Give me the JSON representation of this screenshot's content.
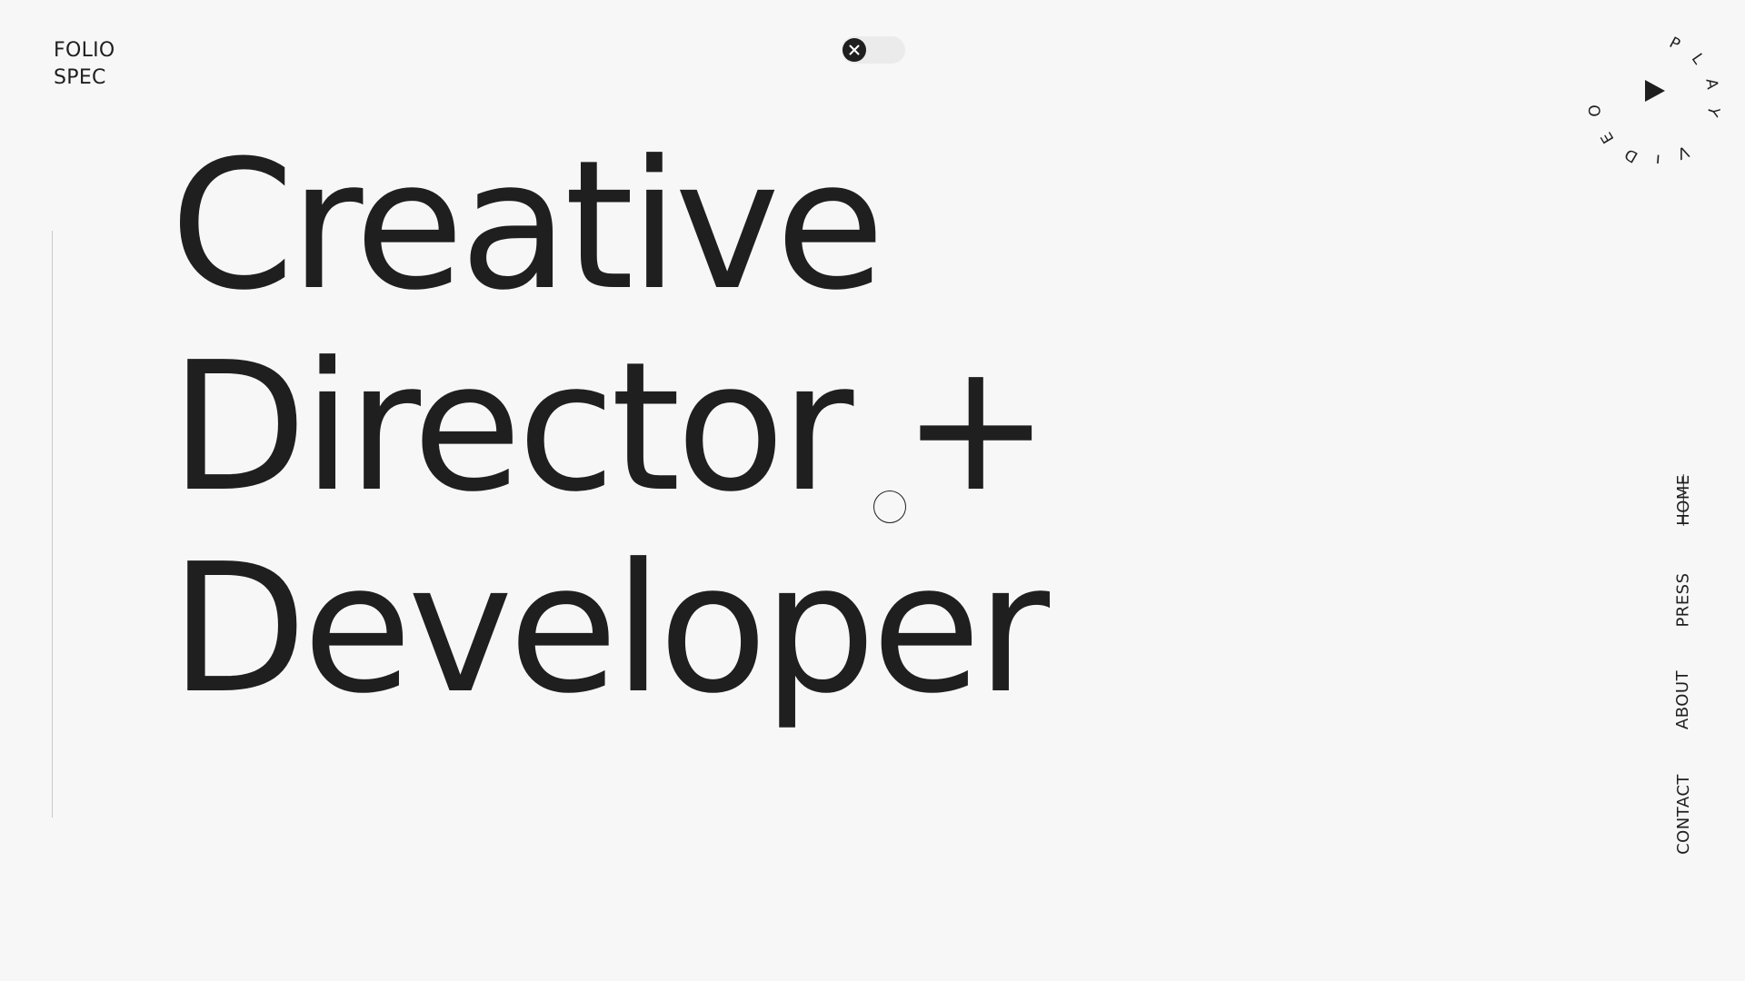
{
  "brand": {
    "line1": "FOLIO",
    "line2": "SPEC"
  },
  "toggle": {
    "state": "off",
    "knob_icon": "close-icon"
  },
  "video_badge": {
    "circular_text": "PLAY VIDEO",
    "icon": "play-icon"
  },
  "hero": {
    "line1": "Creative",
    "line2": "Director +",
    "line3": "Developer"
  },
  "nav": {
    "items": [
      {
        "label": "HOME",
        "active": true
      },
      {
        "label": "PRESS",
        "active": false
      },
      {
        "label": "ABOUT",
        "active": false
      },
      {
        "label": "CONTACT",
        "active": false
      }
    ]
  },
  "colors": {
    "background": "#f7f7f7",
    "ink": "#1f1f1f",
    "toggle_track": "#ebebeb"
  }
}
